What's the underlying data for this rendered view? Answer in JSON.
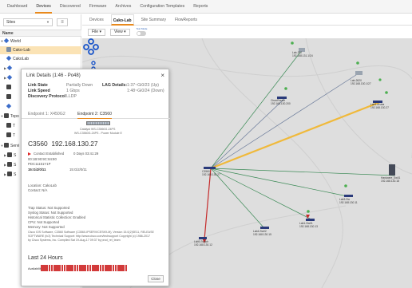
{
  "nav": {
    "tabs": [
      {
        "label": "Dashboard"
      },
      {
        "label": "Devices"
      },
      {
        "label": "Discovered"
      },
      {
        "label": "Firmware"
      },
      {
        "label": "Archives"
      },
      {
        "label": "Configuration Templates"
      },
      {
        "label": "Reports"
      }
    ],
    "active": "Devices"
  },
  "sidebar": {
    "site_select": "Sites",
    "header": "Name",
    "tree": [
      {
        "label": "World"
      },
      {
        "label": "Cako-Lab"
      },
      {
        "label": "CakoLab"
      },
      {
        "label": ""
      },
      {
        "label": ""
      },
      {
        "label": ""
      },
      {
        "label": ""
      },
      {
        "label": ""
      },
      {
        "label": "Topo"
      },
      {
        "label": "T"
      },
      {
        "label": "T"
      },
      {
        "label": "Servi"
      },
      {
        "label": "S"
      },
      {
        "label": "S"
      },
      {
        "label": "S"
      }
    ]
  },
  "subtabs": [
    "Devices",
    "Cako-Lab",
    "Site Summary",
    "FlowReports"
  ],
  "toolbar": {
    "file": "File",
    "view": "View",
    "test_mode_label": "Test Mode"
  },
  "map_nodes": [
    {
      "label": "Lab-192\n192.168.131.1/24"
    },
    {
      "label": "Lab-2620\n192.168.130.1/27"
    },
    {
      "label": "CiscoRouter\n192.168.130.200"
    },
    {
      "label": "Lab1-Aruba\n192.168.130.27"
    },
    {
      "label": "C3560\n192.168.130.27"
    },
    {
      "label": "Hardware_Sw01\n192.168.130.18"
    },
    {
      "label": "Lab3-Sw\n192.168.130.11"
    },
    {
      "label": "Lab1-Sw01\n192.168.130.13"
    },
    {
      "label": "Lab4-Sw02\n192.168.130.15"
    },
    {
      "label": "Lab5-Switch\n192.168.130.12"
    }
  ],
  "dialog": {
    "title": "Link Details (1:46 - Po48)",
    "link_state_label": "Link State",
    "link_state_value": "Partially Down",
    "link_speed_label": "Link Speed",
    "link_speed_value": "1 Gbps",
    "discovery_label": "Discovery Protocol",
    "discovery_value": "LLDP",
    "lag_label": "LAG Details:",
    "lag_line1": "1:37~Gi0/23 (Up)",
    "lag_line2": "1:48~Gi0/24 (Down)",
    "tab1": "Endpoint 1: X450G2",
    "tab2": "Endpoint 2: C3560",
    "model_line1": "Catalyst WS-C3560G-24PS",
    "model_line2": "WS-C3560G-24PS - Power Module E",
    "device_name": "C3560",
    "device_ip": "192.168.130.27",
    "contact_label": "Contact Established",
    "contact_value": "0 Days 03:41:29",
    "mac": "00:1B:90:9C:84:80",
    "mac2": "PDC11151Y1P",
    "port": "15:Gi2/0/11",
    "port2": "15:Gi2/0/11",
    "location": "Location: CakoLab",
    "contact": "Contact: N/A",
    "status_lines": [
      "Trap Status: Not Supported",
      "Syslog Status: Not Supported",
      "Historical Statistic Collection: Enabled",
      "CPU: Not Supported",
      "Memory: Not Supported"
    ],
    "description_lines": [
      "Cisco IOS Software, C3560 Software (C3560-IPSERVICESK9-M), Version 15.0(2)SE11, RELEASE",
      "SOFTWARE (fc3) Technical Support: http://www.cisco.com/techsupport Copyright (c) 1986-2017",
      "by Cisco Systems, Inc. Compiled Sat 19-Aug-17 09:37 by prod_rel_team"
    ],
    "last24": "Last 24 Hours",
    "availability": "Availability",
    "availability_samples": 34,
    "close": "Close"
  }
}
